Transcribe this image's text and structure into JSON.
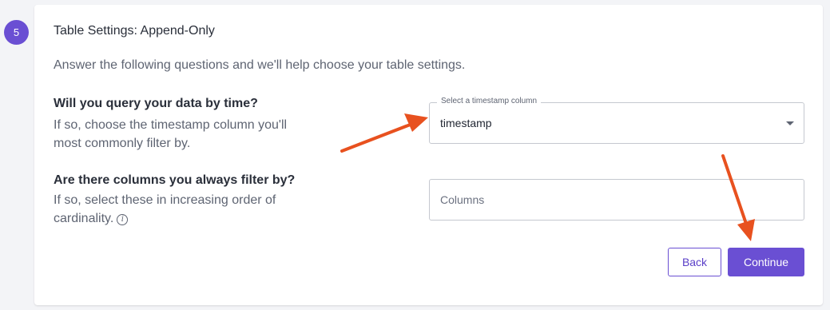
{
  "step": {
    "number": "5"
  },
  "section": {
    "title": "Table Settings: Append-Only",
    "subtitle": "Answer the following questions and we'll help choose your table settings."
  },
  "questions": [
    {
      "title": "Will you query your data by time?",
      "desc_line1": "If so, choose the timestamp column you'll",
      "desc_line2": "most commonly filter by.",
      "field_label": "Select a timestamp column",
      "field_value": "timestamp"
    },
    {
      "title": "Are there columns you always filter by?",
      "desc_line1": "If so, select these in increasing order of",
      "desc_line2": "cardinality.",
      "field_placeholder": "Columns"
    }
  ],
  "buttons": {
    "back": "Back",
    "continue": "Continue"
  },
  "icons": {
    "info": "info-circle-icon",
    "dropdown": "caret-down-icon",
    "annotation": "arrow-annotation-icon"
  },
  "colors": {
    "accent": "#6a4fd3",
    "annotation": "#e8511f"
  }
}
